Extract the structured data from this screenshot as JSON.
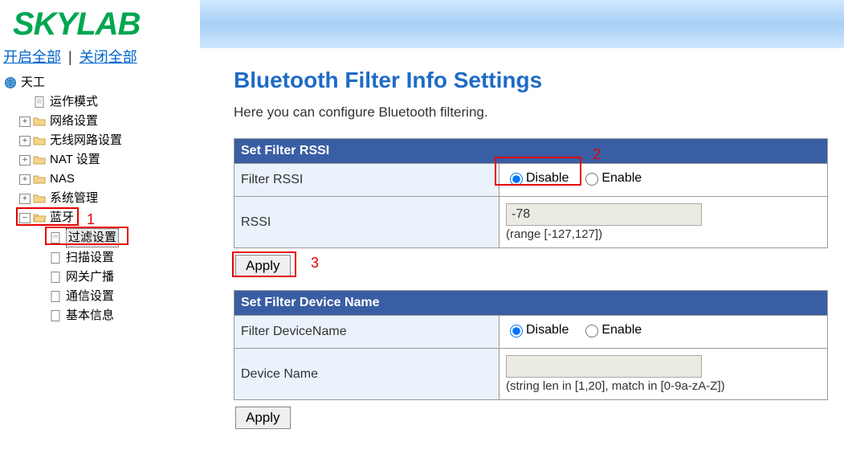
{
  "logo_text": "SKYLAB",
  "top_links": {
    "open_all": "开启全部",
    "close_all": "关闭全部"
  },
  "tree": {
    "root": "天工",
    "items": [
      {
        "label": "运作模式",
        "type": "page"
      },
      {
        "label": "网络设置",
        "type": "folder",
        "expandable": true
      },
      {
        "label": "无线网路设置",
        "type": "folder",
        "expandable": true
      },
      {
        "label": "NAT 设置",
        "type": "folder",
        "expandable": true
      },
      {
        "label": "NAS",
        "type": "folder",
        "expandable": true
      },
      {
        "label": "系统管理",
        "type": "folder",
        "expandable": true
      },
      {
        "label": "蓝牙",
        "type": "folder",
        "expandable": true,
        "open": true,
        "children": [
          {
            "label": "过滤设置",
            "selected": true
          },
          {
            "label": "扫描设置"
          },
          {
            "label": "网关广播"
          },
          {
            "label": "通信设置"
          },
          {
            "label": "基本信息"
          }
        ]
      }
    ]
  },
  "page": {
    "title": "Bluetooth Filter Info Settings",
    "subtitle": "Here you can configure Bluetooth filtering."
  },
  "sections": {
    "rssi": {
      "header": "Set Filter RSSI",
      "row1_label": "Filter RSSI",
      "disable": "Disable",
      "enable": "Enable",
      "row2_label": "RSSI",
      "value": "-78",
      "hint": "(range [-127,127])",
      "apply": "Apply"
    },
    "devname": {
      "header": "Set Filter Device Name",
      "row1_label": "Filter DeviceName",
      "disable": "Disable",
      "enable": "Enable",
      "row2_label": "Device Name",
      "value": "",
      "hint": "(string len in [1,20], match in [0-9a-zA-Z])",
      "apply": "Apply"
    }
  },
  "annotations": {
    "n1": "1",
    "n2": "2",
    "n3": "3"
  }
}
